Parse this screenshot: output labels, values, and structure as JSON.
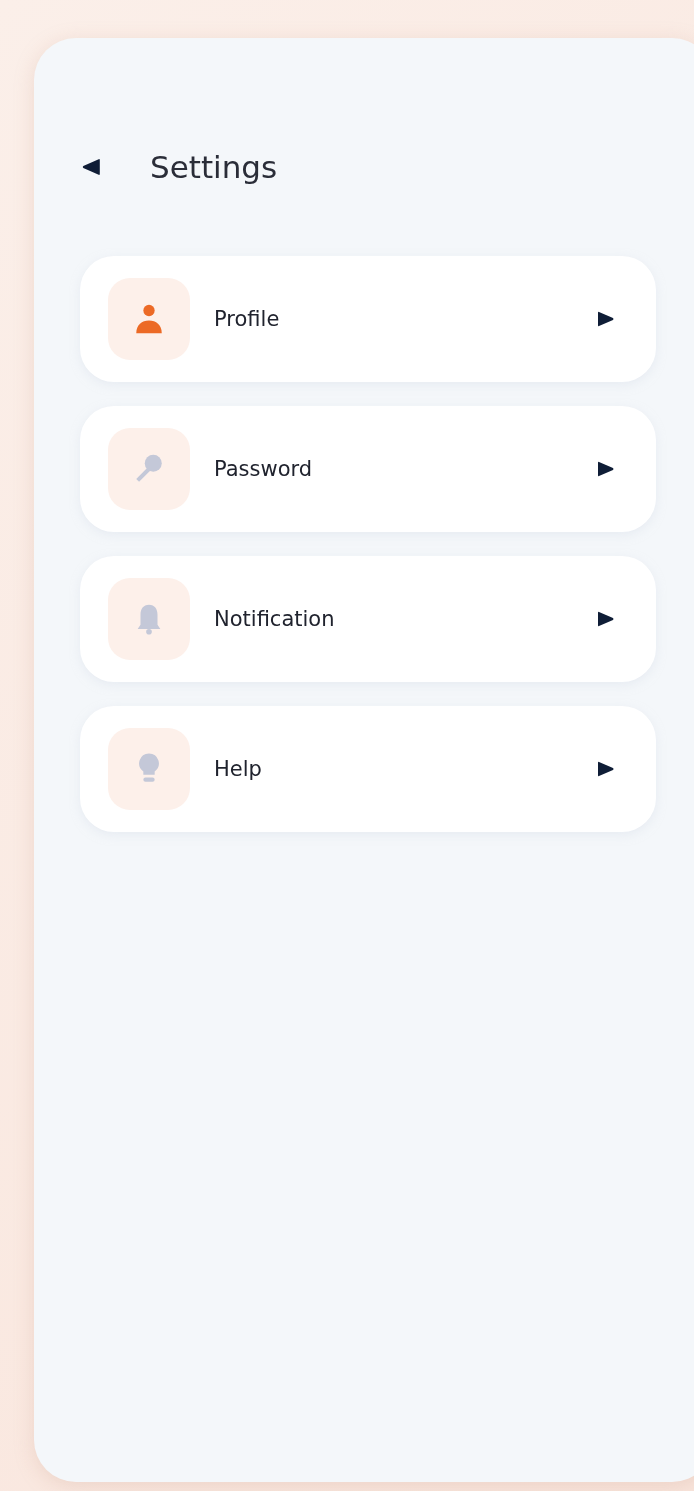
{
  "header": {
    "title": "Settings"
  },
  "items": [
    {
      "label": "Profile",
      "kind": "person",
      "selected": true
    },
    {
      "label": "Password",
      "kind": "key",
      "selected": false
    },
    {
      "label": "Notification",
      "kind": "bell",
      "selected": false
    },
    {
      "label": "Help",
      "kind": "bulb",
      "selected": false
    }
  ]
}
